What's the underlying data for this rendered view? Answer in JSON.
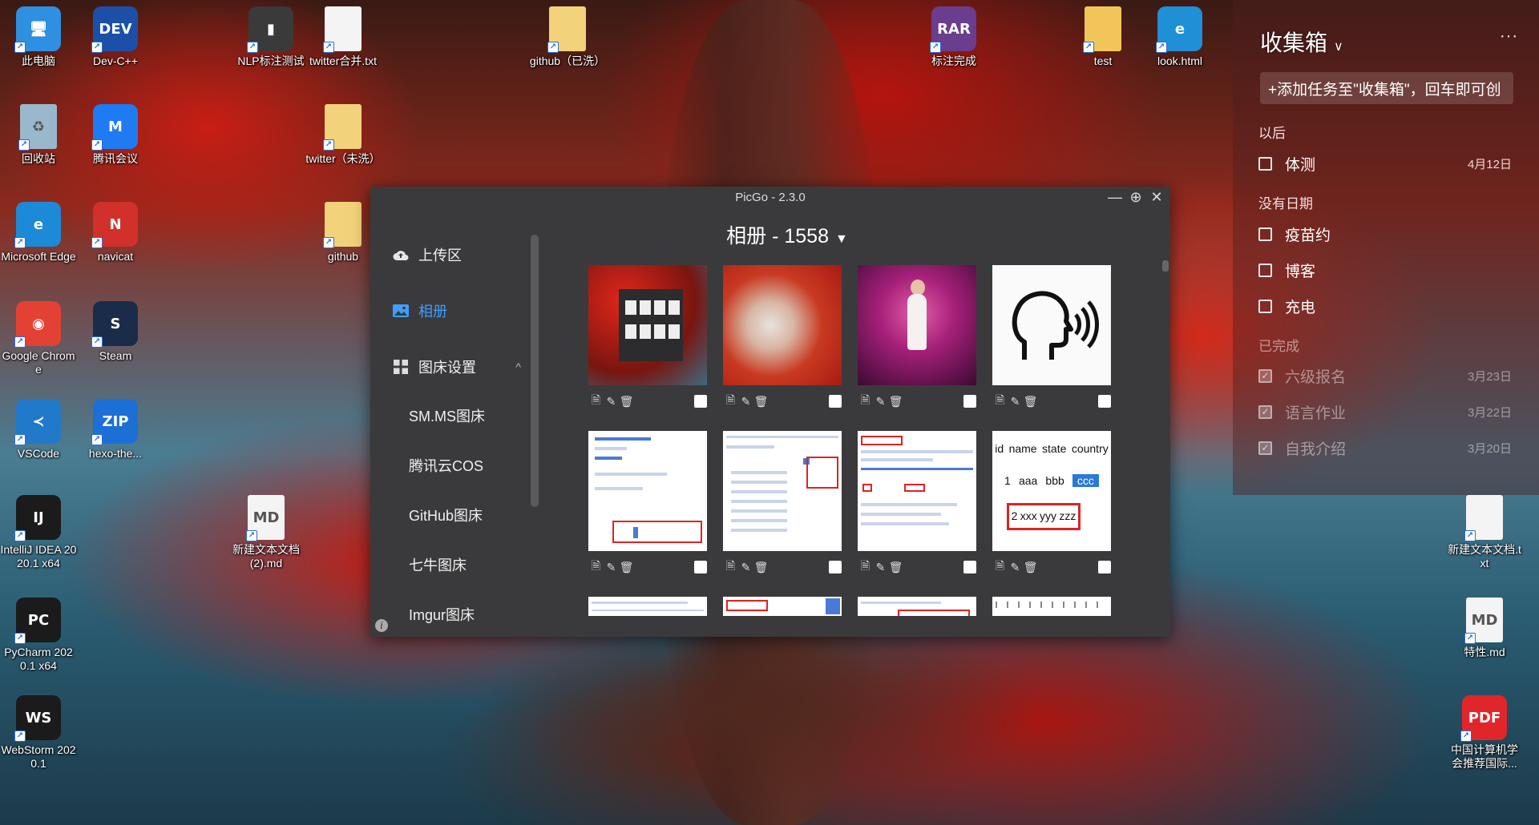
{
  "desktop": {
    "icons": [
      {
        "label": "此电脑",
        "glyph": "🖥",
        "color": "#2f8fe0"
      },
      {
        "label": "Dev-C++",
        "glyph": "DEV",
        "color": "#1c4fa8"
      },
      {
        "label": "NLP标注测试",
        "glyph": "▮",
        "color": "#3a3a3a"
      },
      {
        "label": "twitter合并.txt",
        "glyph": "",
        "color": "#f4f4f4"
      },
      {
        "label": "github（已洗）",
        "glyph": "",
        "color": "#f2d27a"
      },
      {
        "label": "标注完成",
        "glyph": "RAR",
        "color": "#6a3d8f"
      },
      {
        "label": "test",
        "glyph": "",
        "color": "#f2c55a"
      },
      {
        "label": "look.html",
        "glyph": "e",
        "color": "#1f8fd6"
      },
      {
        "label": "回收站",
        "glyph": "♻",
        "color": "#9ab8cc"
      },
      {
        "label": "腾讯会议",
        "glyph": "M",
        "color": "#1f7bf2"
      },
      {
        "label": "twitter（未洗）",
        "glyph": "",
        "color": "#f2d27a"
      },
      {
        "label": "Microsoft Edge",
        "glyph": "e",
        "color": "#1c8ad6"
      },
      {
        "label": "navicat",
        "glyph": "N",
        "color": "#d2302a"
      },
      {
        "label": "github",
        "glyph": "",
        "color": "#f2d27a"
      },
      {
        "label": "Google Chrome",
        "glyph": "◉",
        "color": "#e34133"
      },
      {
        "label": "Steam",
        "glyph": "S",
        "color": "#1b2c4a"
      },
      {
        "label": "VSCode",
        "glyph": "≺",
        "color": "#2179c9"
      },
      {
        "label": "hexo-the...",
        "glyph": "ZIP",
        "color": "#1c6fd6"
      },
      {
        "label": "IntelliJ IDEA 2020.1 x64",
        "glyph": "IJ",
        "color": "#1b1b1b"
      },
      {
        "label": "新建文本文档 (2).md",
        "glyph": "MD",
        "color": "#f4f4f4"
      },
      {
        "label": "PyCharm 2020.1 x64",
        "glyph": "PC",
        "color": "#1b1b1b"
      },
      {
        "label": "WebStorm 2020.1",
        "glyph": "WS",
        "color": "#1b1b1b"
      },
      {
        "label": "新建文本文档.txt",
        "glyph": "",
        "color": "#f4f4f4"
      },
      {
        "label": "特性.md",
        "glyph": "MD",
        "color": "#f4f4f4"
      },
      {
        "label": "中国计算机学会推荐国际...",
        "glyph": "PDF",
        "color": "#e0262a"
      }
    ]
  },
  "todo": {
    "title": "收集箱",
    "chevron": "∨",
    "more": "···",
    "input_placeholder": "+添加任务至\"收集箱\"，回车即可创",
    "sections": [
      {
        "name": "以后"
      },
      {
        "name": "没有日期"
      },
      {
        "name": "已完成"
      }
    ],
    "items": [
      {
        "text": "体测",
        "date": "4月12日",
        "done": false
      },
      {
        "text": "疫苗约",
        "date": "",
        "done": false
      },
      {
        "text": "博客",
        "date": "",
        "done": false
      },
      {
        "text": "充电",
        "date": "",
        "done": false
      },
      {
        "text": "六级报名",
        "date": "3月23日",
        "done": true
      },
      {
        "text": "语言作业",
        "date": "3月22日",
        "done": true
      },
      {
        "text": "自我介绍",
        "date": "3月20日",
        "done": true
      }
    ]
  },
  "picgo": {
    "title": "PicGo - 2.3.0",
    "minimize": "—",
    "maximize": "⊕",
    "close": "✕",
    "nav": {
      "upload": "上传区",
      "album": "相册",
      "settings": "图床设置",
      "settings_chevron": "^"
    },
    "hosts": [
      "SM.MS图床",
      "腾讯云COS",
      "GitHub图床",
      "七牛图床",
      "Imgur图床"
    ],
    "album_heading": "相册 - 1558",
    "dropdown": "▼",
    "info": "i",
    "tool_icons": {
      "copy": "🗎",
      "edit": "✎",
      "delete": "🗑"
    },
    "doc_text": {
      "t8_header": [
        "id",
        "name",
        "state",
        "country"
      ],
      "t8_row1": [
        "1",
        "aaa",
        "bbb",
        "ccc"
      ],
      "t8_row2": [
        "2",
        "xxx",
        "yyy",
        "zzz"
      ]
    }
  }
}
